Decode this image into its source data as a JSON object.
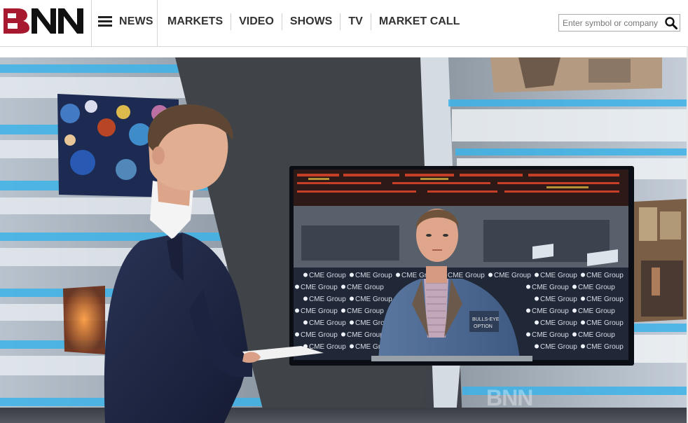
{
  "site": {
    "logo_text": "BNN",
    "brand_color": "#a6192e"
  },
  "nav": {
    "menu_label": "NEWS",
    "items": [
      "MARKETS",
      "VIDEO",
      "SHOWS",
      "TV",
      "MARKET CALL"
    ]
  },
  "search": {
    "placeholder": "Enter symbol or company",
    "value": "",
    "icon": "search-icon"
  },
  "video": {
    "watermark": "BNN",
    "screen_ticker_text": "CME Group",
    "jacket_badge": "BULLS-EYE OPTION"
  }
}
